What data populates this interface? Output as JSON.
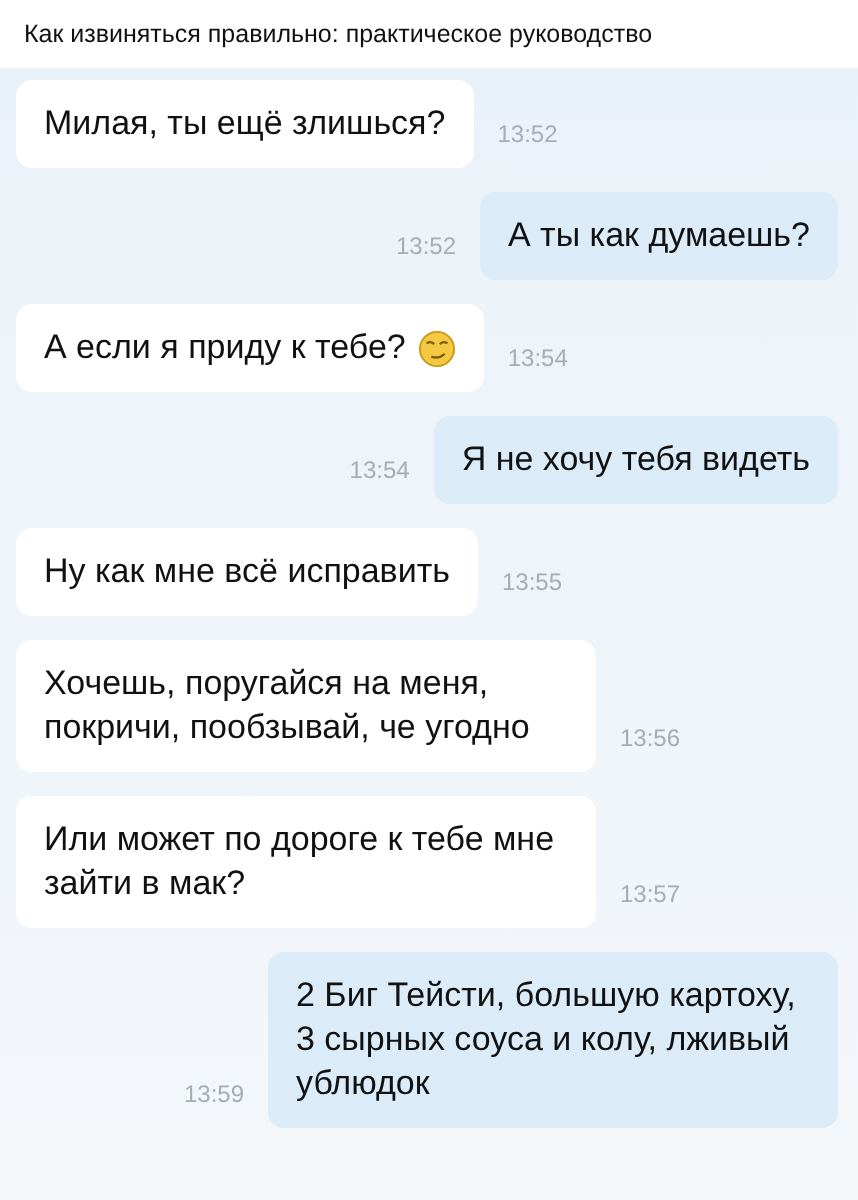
{
  "title": "Как извиняться правильно: практическое руководство",
  "messages": [
    {
      "kind": "incoming",
      "text": "Милая, ты ещё злишься?",
      "time": "13:52"
    },
    {
      "kind": "outgoing",
      "text": "А ты как думаешь?",
      "time": "13:52"
    },
    {
      "kind": "incoming",
      "text": "А если я приду к тебе?",
      "emoji": true,
      "time": "13:54"
    },
    {
      "kind": "outgoing",
      "text": "Я не хочу тебя видеть",
      "time": "13:54"
    },
    {
      "kind": "incoming",
      "text": "Ну как мне всё исправить",
      "time": "13:55"
    },
    {
      "kind": "incoming",
      "text": "Хочешь, поругайся на меня, покричи, пообзывай, че угодно",
      "time": "13:56"
    },
    {
      "kind": "incoming",
      "text": "Или может по дороге к тебе мне зайти в мак?",
      "time": "13:57"
    },
    {
      "kind": "outgoing",
      "text": "2 Биг Тейсти, большую картоху, 3 сырных соуса и колу, лживый ублюдок",
      "time": "13:59"
    }
  ]
}
